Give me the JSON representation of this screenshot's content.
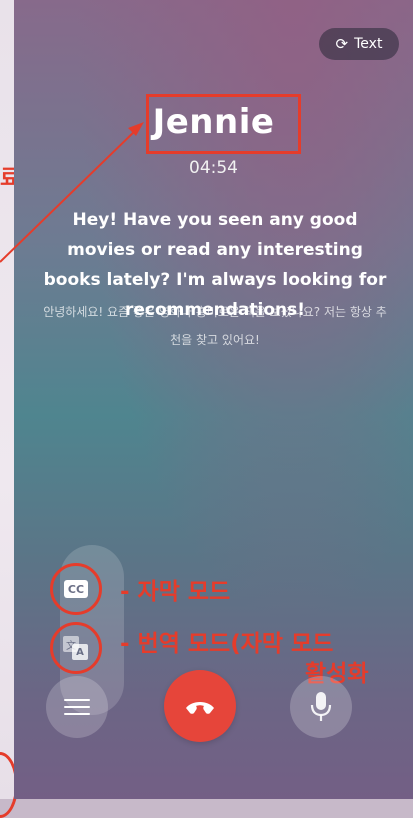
{
  "call": {
    "caller_name": "Jennie",
    "duration": "04:54",
    "text_button_label": "Text",
    "caption_english": "Hey! Have you seen any good movies or read any interesting books lately? I'm always looking for recommendations!",
    "caption_korean": "안녕하세요! 요즘 좋은 영화나 흥미로운 책을 보셨나요? 저는 항상 추천을 찾고 있어요!"
  },
  "modes": {
    "cc_icon_text": "CC",
    "translate_icon_a": "文",
    "translate_icon_b": "A"
  },
  "annotations": {
    "left_text": "료",
    "cc_label": "- 자막 모드",
    "translate_label": "- 번역 모드(자막 모드",
    "translate_label_line2": "활성화 "
  },
  "colors": {
    "annotation_red": "#e53c2b",
    "end_call_red": "#e6453a"
  },
  "icons": {
    "text_button": "refresh-icon",
    "cc": "closed-caption-icon",
    "translate": "translate-icon",
    "menu": "menu-icon",
    "end_call": "phone-hangup-icon",
    "mic": "microphone-icon"
  }
}
